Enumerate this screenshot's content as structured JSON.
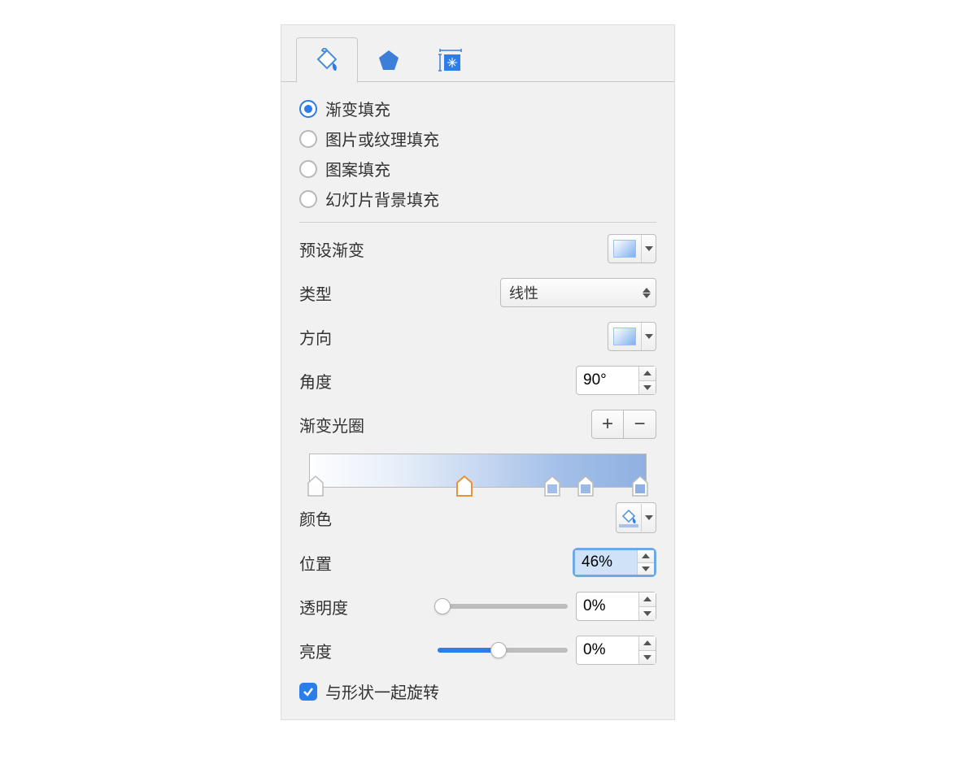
{
  "tabs": {
    "active": 0
  },
  "fill_options": {
    "gradient": "渐变填充",
    "picture": "图片或纹理填充",
    "pattern": "图案填充",
    "slide_bg": "幻灯片背景填充",
    "selected": "gradient"
  },
  "preset": {
    "label": "预设渐变"
  },
  "type": {
    "label": "类型",
    "value": "线性"
  },
  "direction": {
    "label": "方向"
  },
  "angle": {
    "label": "角度",
    "value": "90°"
  },
  "stops": {
    "label": "渐变光圈",
    "positions": [
      2,
      46,
      72,
      82,
      98
    ],
    "selected_index": 1
  },
  "color": {
    "label": "颜色"
  },
  "position": {
    "label": "位置",
    "value": "46%"
  },
  "transparency": {
    "label": "透明度",
    "value": "0%",
    "slider": 0
  },
  "brightness": {
    "label": "亮度",
    "value": "0%",
    "slider": 47
  },
  "rotate": {
    "label": "与形状一起旋转",
    "checked": true
  }
}
